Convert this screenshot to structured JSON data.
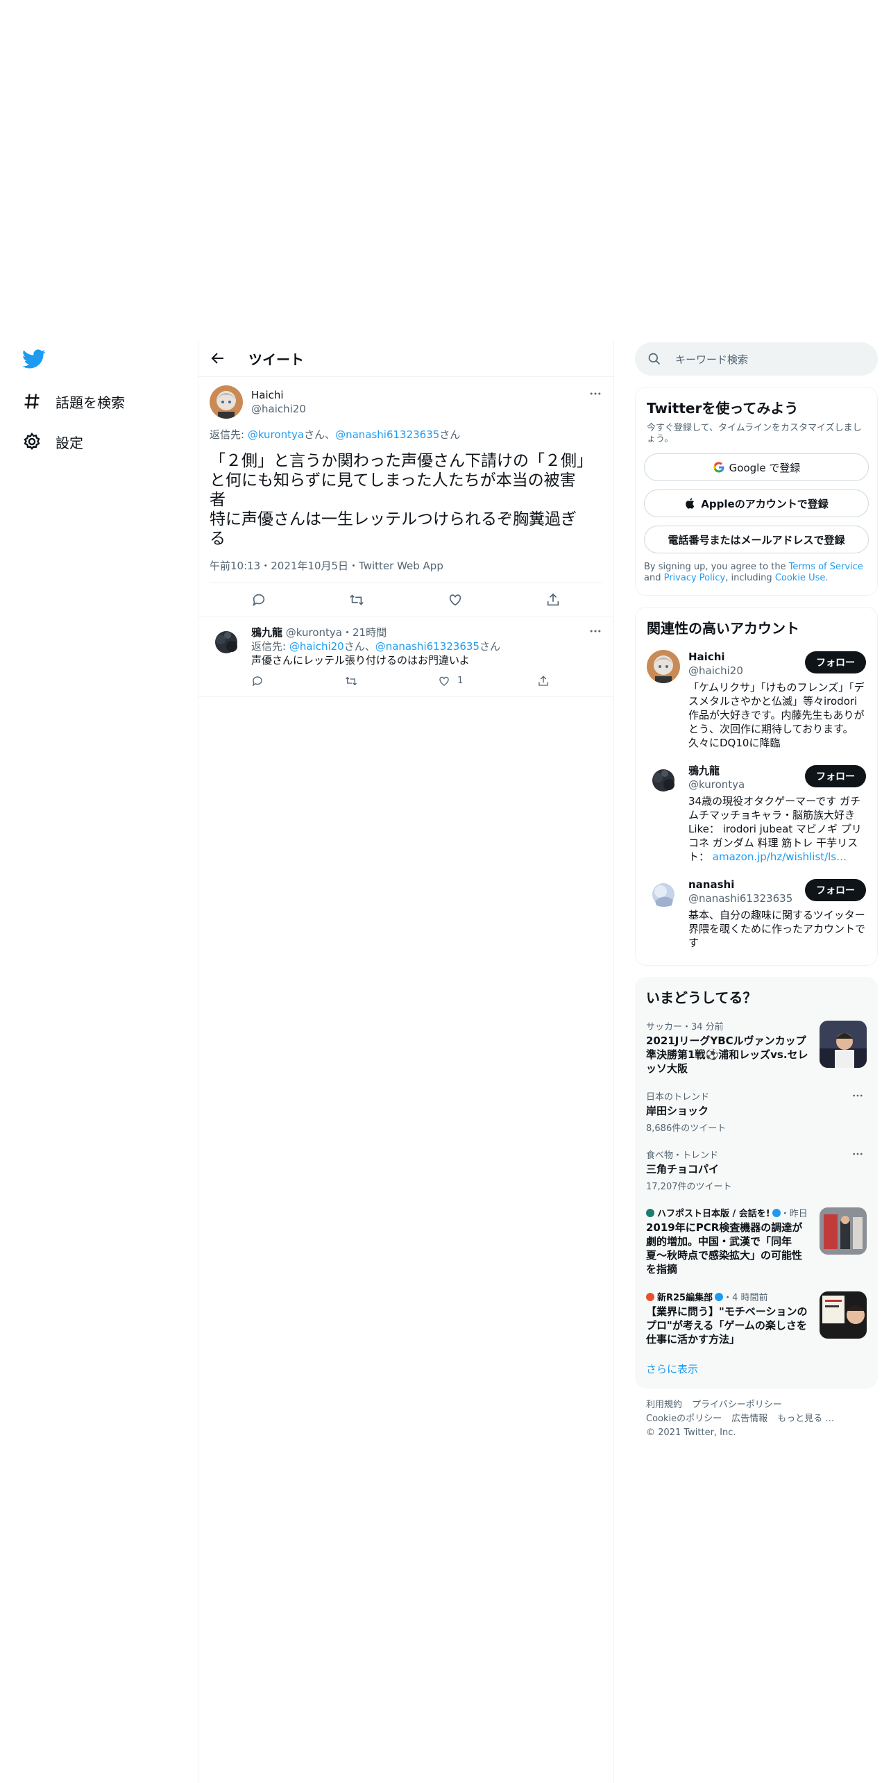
{
  "nav": {
    "explore_label": "話題を検索",
    "settings_label": "設定"
  },
  "header": {
    "title": "ツイート"
  },
  "main_tweet": {
    "name": "Haichi",
    "handle": "@haichi20",
    "reply_prefix": "返信先: ",
    "reply_user1": "@kurontya",
    "reply_san1": "さん、",
    "reply_user2": "@nanashi61323635",
    "reply_san2": "さん",
    "body": "「２側」と言うか関わった声優さん下請けの「２側」\nと何にも知らずに見てしまった人たちが本当の被害\n者\n特に声優さんは一生レッテルつけられるぞ胸糞過ぎ\nる",
    "timestamp": "午前10:13・2021年10月5日・Twitter Web App"
  },
  "reply": {
    "name": "鴉九龍",
    "handle": "@kurontya",
    "time": "・21時間",
    "reply_prefix": "返信先: ",
    "reply_user1": "@haichi20",
    "reply_san1": "さん、",
    "reply_user2": "@nanashi61323635",
    "reply_san2": "さん",
    "body": "声優さんにレッテル張り付けるのはお門違いよ",
    "like_count": "1"
  },
  "search": {
    "placeholder": "キーワード検索"
  },
  "signup": {
    "title": "Twitterを使ってみよう",
    "subtitle": "今すぐ登録して、タイムラインをカスタマイズしましょう。",
    "google": "Google で登録",
    "apple": "Appleのアカウントで登録",
    "phone": "電話番号またはメールアドレスで登録",
    "legal_pre": "By signing up, you agree to the ",
    "terms": "Terms of Service",
    "and": " and ",
    "privacy": "Privacy Policy",
    "including": ", including ",
    "cookie": "Cookie Use."
  },
  "relevant": {
    "title": "関連性の高いアカウント",
    "follow": "フォロー",
    "accounts": [
      {
        "name": "Haichi",
        "handle": "@haichi20",
        "bio": "「ケムリクサ」「けものフレンズ」「デスメタルさやかと仏滅」等々irodori作品が大好きです。内藤先生もありがとう、次回作に期待しております。久々にDQ10に降臨"
      },
      {
        "name": "鴉九龍",
        "handle": "@kurontya",
        "bio": "34歳の現役オタクゲーマーです ガチムチマッチョキャラ・脳筋族大好き Like： irodori jubeat マビノギ プリコネ ガンダム 料理 筋トレ 干芋リスト：",
        "link": "amazon.jp/hz/wishlist/ls…"
      },
      {
        "name": "nanashi",
        "handle": "@nanashi61323635",
        "bio": "基本、自分の趣味に関するツイッター界隈を覗くために作ったアカウントです"
      }
    ]
  },
  "trends": {
    "title": "いまどうしてる？",
    "items": [
      {
        "meta": "サッカー・34 分前",
        "title": "2021JリーグYBCルヴァンカップ準決勝第1戦⚽浦和レッズvs.セレッソ大阪"
      },
      {
        "meta": "日本のトレンド",
        "title": "岸田ショック",
        "count": "8,686件のツイート"
      },
      {
        "meta": "食べ物・トレンド",
        "title": "三角チョコパイ",
        "count": "17,207件のツイート"
      },
      {
        "meta": "ハフポスト日本版 / 会話を!",
        "meta2": "・昨日",
        "title": "2019年にPCR検査機器の調達が劇的増加。中国・武漢で「同年夏〜秋時点で感染拡大」の可能性を指摘"
      },
      {
        "meta": "新R25編集部",
        "meta2": "・4 時間前",
        "title": "【業界に問う】\"モチベーションのプロ\"が考える「ゲームの楽しさを仕事に活かす方法」"
      }
    ],
    "show_more": "さらに表示"
  },
  "footer": {
    "terms": "利用規約",
    "privacy": "プライバシーポリシー",
    "cookie": "Cookieのポリシー",
    "ads": "広告情報",
    "more": "もっと見る …",
    "copyright": "© 2021 Twitter, Inc."
  },
  "colors": {
    "accent": "#1d9bf0",
    "text": "#0f1419",
    "muted": "#536471"
  }
}
